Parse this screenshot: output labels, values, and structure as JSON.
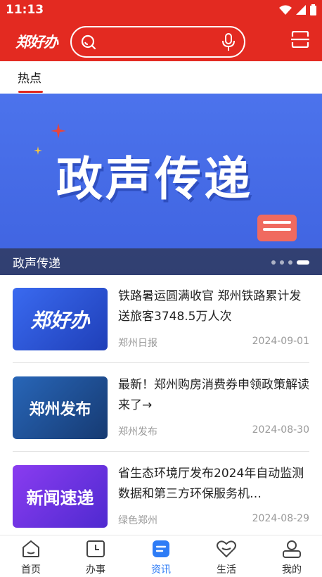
{
  "status_bar": {
    "time": "11:13"
  },
  "header": {
    "logo_text": "郑好办",
    "search_placeholder": "",
    "icons": {
      "search": "search-icon",
      "mic": "microphone-icon",
      "scan": "scan-icon"
    }
  },
  "tabs": [
    {
      "label": "热点",
      "active": true
    }
  ],
  "banner": {
    "title_art": "政声传递",
    "caption": "政声传递",
    "dots": 4,
    "active_dot": 3
  },
  "news": [
    {
      "title": "铁路暑运圆满收官 郑州铁路累计发送旅客3748.5万人次",
      "source": "郑州日报",
      "date": "2024-09-01",
      "thumb_text": "郑好办",
      "thumb_color": "#2f57d9"
    },
    {
      "title": "最新！郑州购房消费券申领政策解读来了→",
      "source": "郑州发布",
      "date": "2024-08-30",
      "thumb_text": "郑州发布",
      "thumb_color": "#1d4d8c"
    },
    {
      "title": "省生态环境厅发布2024年自动监测数据和第三方环保服务机…",
      "source": "绿色郑州",
      "date": "2024-08-29",
      "thumb_text": "新闻速递",
      "thumb_color": "#6a2fd6"
    }
  ],
  "bottom_nav": [
    {
      "label": "首页",
      "icon": "home-icon",
      "active": false
    },
    {
      "label": "办事",
      "icon": "clock-icon",
      "active": false
    },
    {
      "label": "资讯",
      "icon": "news-icon",
      "active": true
    },
    {
      "label": "生活",
      "icon": "heart-icon",
      "active": false
    },
    {
      "label": "我的",
      "icon": "profile-icon",
      "active": false
    }
  ],
  "colors": {
    "brand_red": "#e32a21",
    "active_blue": "#2e7cf6"
  }
}
